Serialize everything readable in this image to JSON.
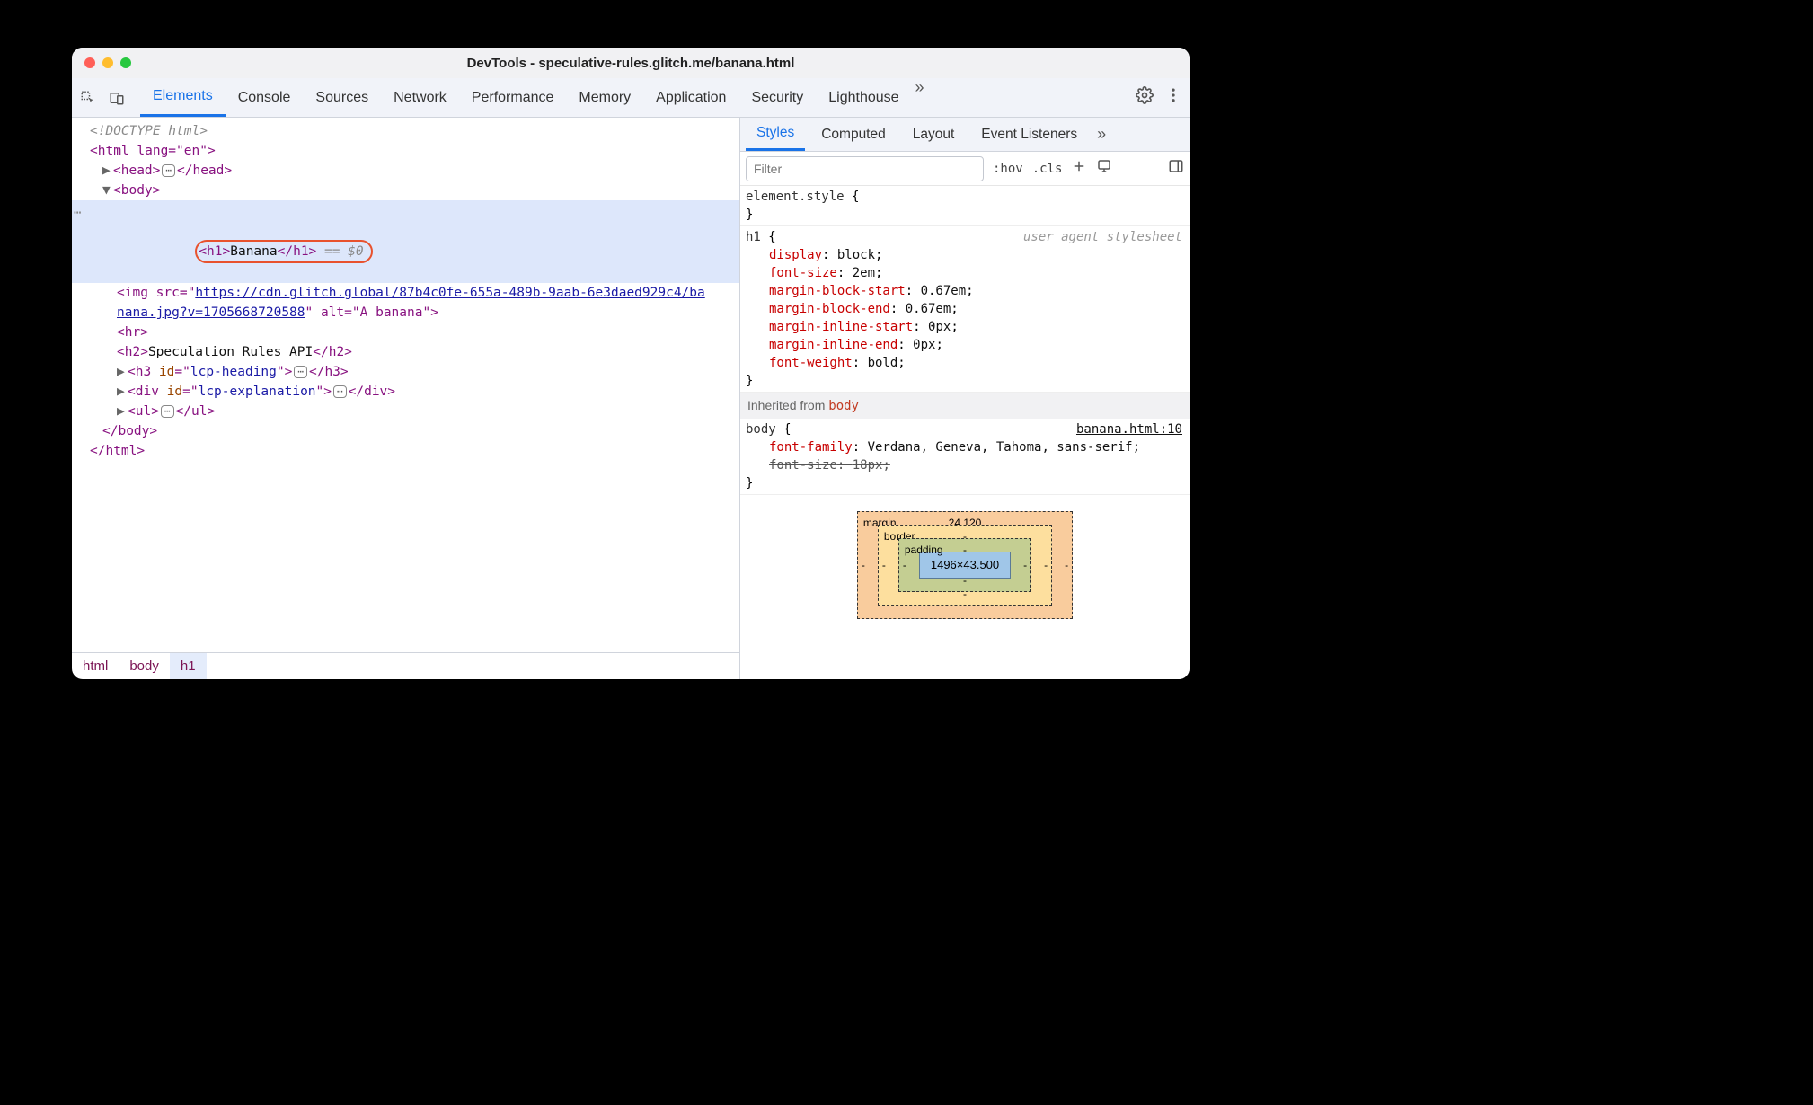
{
  "window": {
    "title": "DevTools - speculative-rules.glitch.me/banana.html"
  },
  "main_tabs": {
    "items": [
      "Elements",
      "Console",
      "Sources",
      "Network",
      "Performance",
      "Memory",
      "Application",
      "Security",
      "Lighthouse"
    ],
    "active_index": 0,
    "overflow_glyph": "»"
  },
  "dom": {
    "doctype": "<!DOCTYPE html>",
    "html_open": "<html lang=\"en\">",
    "head": "<head>…</head>",
    "body_open": "<body>",
    "selected": {
      "tag_open": "<h1>",
      "text": "Banana",
      "tag_close": "</h1>",
      "suffix": " == $0"
    },
    "img_line1_pre": "<img src=\"",
    "img_url_part1": "https://cdn.glitch.global/87b4c0fe-655a-489b-9aab-6e3daed929c4/ba",
    "img_url_part2": "nana.jpg?v=1705668720588",
    "img_line2_post": "\" alt=\"A banana\">",
    "hr": "<hr>",
    "h2": {
      "open": "<h2>",
      "text": "Speculation Rules API",
      "close": "</h2>"
    },
    "h3": "<h3 id=\"lcp-heading\">…</h3>",
    "div": "<div id=\"lcp-explanation\">…</div>",
    "ul": "<ul>…</ul>",
    "body_close": "</body>",
    "html_close": "</html>"
  },
  "breadcrumbs": [
    "html",
    "body",
    "h1"
  ],
  "side_tabs": {
    "items": [
      "Styles",
      "Computed",
      "Layout",
      "Event Listeners"
    ],
    "active_index": 0,
    "overflow_glyph": "»"
  },
  "filterbar": {
    "placeholder": "Filter",
    "hov": ":hov",
    "cls": ".cls"
  },
  "styles": {
    "element_style": {
      "selector": "element.style",
      "open": " {",
      "close": "}"
    },
    "h1_rule": {
      "selector": "h1",
      "origin": "user agent stylesheet",
      "open": " {",
      "close": "}",
      "decls": [
        {
          "prop": "display",
          "val": "block"
        },
        {
          "prop": "font-size",
          "val": "2em"
        },
        {
          "prop": "margin-block-start",
          "val": "0.67em"
        },
        {
          "prop": "margin-block-end",
          "val": "0.67em"
        },
        {
          "prop": "margin-inline-start",
          "val": "0px"
        },
        {
          "prop": "margin-inline-end",
          "val": "0px"
        },
        {
          "prop": "font-weight",
          "val": "bold"
        }
      ]
    },
    "inherited_label": "Inherited from ",
    "inherited_from": "body",
    "body_rule": {
      "selector": "body",
      "source": "banana.html:10",
      "open": " {",
      "close": "}",
      "decls": [
        {
          "prop": "font-family",
          "val": "Verdana, Geneva, Tahoma, sans-serif",
          "strike": false
        },
        {
          "prop": "font-size",
          "val": "18px",
          "strike": true
        }
      ]
    }
  },
  "box_model": {
    "margin": {
      "label": "margin",
      "top": "24.120",
      "right": "-",
      "bottom": "-",
      "left": "-"
    },
    "border": {
      "label": "border",
      "top": "-",
      "right": "-",
      "bottom": "-",
      "left": "-"
    },
    "padding": {
      "label": "padding",
      "top": "-",
      "right": "-",
      "bottom": "-",
      "left": "-"
    },
    "content": "1496×43.500"
  }
}
